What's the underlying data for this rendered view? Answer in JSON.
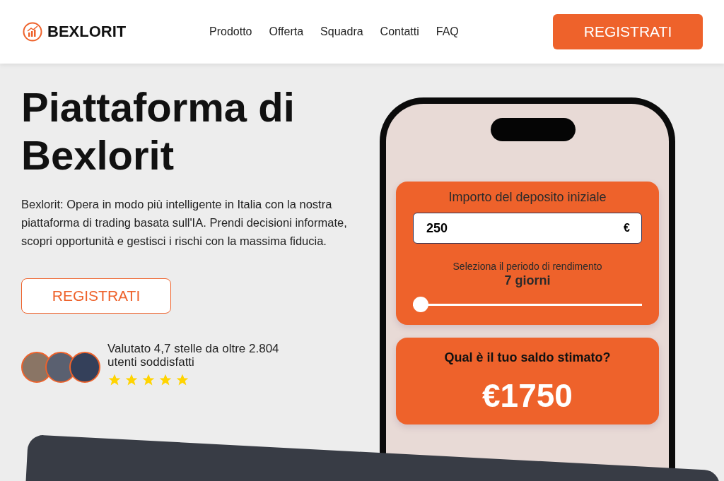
{
  "header": {
    "brand": "BEXLORIT",
    "nav": [
      {
        "label": "Prodotto"
      },
      {
        "label": "Offerta"
      },
      {
        "label": "Squadra"
      },
      {
        "label": "Contatti"
      },
      {
        "label": "FAQ"
      }
    ],
    "cta": "REGISTRATI"
  },
  "hero": {
    "title": "Piattaforma di Bexlorit",
    "description": "Bexlorit: Opera in modo più intelligente in Italia con la nostra piattaforma di trading basata sull'IA. Prendi decisioni informate, scopri opportunità e gestisci i rischi con la massima fiducia.",
    "cta": "REGISTRATI",
    "rating": {
      "text": "Valutato 4,7 stelle da oltre 2.804 utenti soddisfatti",
      "stars": 5
    }
  },
  "calculator": {
    "deposit_label": "Importo del deposito iniziale",
    "deposit_value": "250",
    "currency": "€",
    "period_label": "Seleziona il periodo di rendimento",
    "period_value": "7 giorni",
    "period_slider": {
      "level": 0
    },
    "result_label": "Qual è il tuo saldo stimato?",
    "result_value": "€1750"
  }
}
